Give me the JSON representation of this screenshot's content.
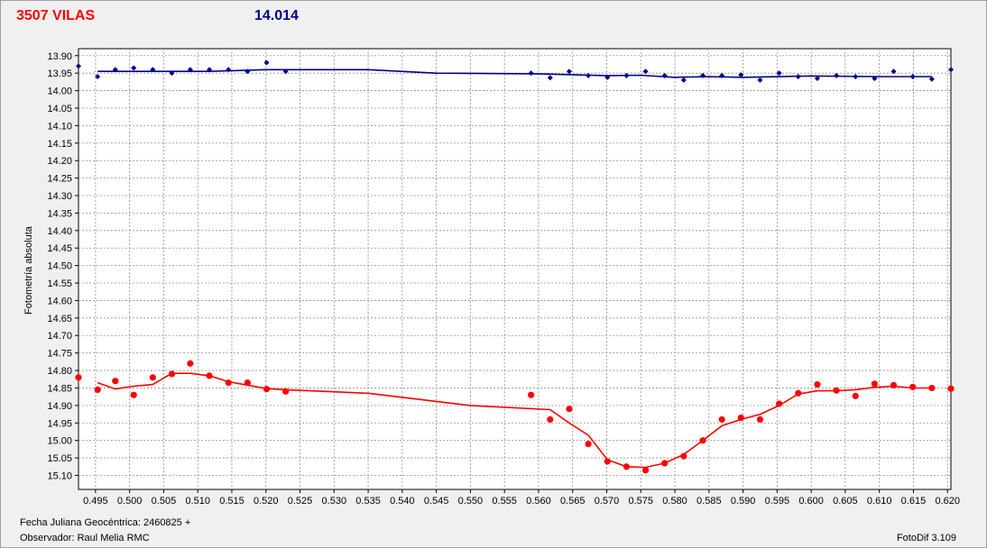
{
  "header": {
    "object_name": "3507 VILAS",
    "reference_value": "14.014"
  },
  "footer": {
    "jd_label": "Fecha Juliana Geocéntrica: 2460825 +",
    "observer": "Observador: Raul Melia RMC",
    "software": "FotoDif 3.109"
  },
  "colors": {
    "series_blue": "#00008b",
    "series_red": "#ff0000",
    "title_red": "#ff0000",
    "title_blue": "#00008b",
    "grid": "#909090"
  },
  "chart_data": {
    "type": "scatter",
    "title": "",
    "xlabel": "",
    "ylabel": "Fotometría absoluta",
    "xlim": [
      0.4925,
      0.6205
    ],
    "ylim": [
      13.88,
      15.14
    ],
    "y_inverted": true,
    "grid": true,
    "x_ticks": [
      0.495,
      0.5,
      0.505,
      0.51,
      0.515,
      0.52,
      0.525,
      0.53,
      0.535,
      0.54,
      0.545,
      0.55,
      0.555,
      0.56,
      0.565,
      0.57,
      0.575,
      0.58,
      0.585,
      0.59,
      0.595,
      0.6,
      0.605,
      0.61,
      0.615,
      0.62
    ],
    "y_ticks": [
      13.9,
      13.95,
      14.0,
      14.05,
      14.1,
      14.15,
      14.2,
      14.25,
      14.3,
      14.35,
      14.4,
      14.45,
      14.5,
      14.55,
      14.6,
      14.65,
      14.7,
      14.75,
      14.8,
      14.85,
      14.9,
      14.95,
      15.0,
      15.05,
      15.1
    ],
    "series": [
      {
        "color": "#00008b",
        "points": [
          [
            0.4925,
            13.93
          ],
          [
            0.4953,
            13.96
          ],
          [
            0.4979,
            13.94
          ],
          [
            0.5006,
            13.935
          ],
          [
            0.5034,
            13.94
          ],
          [
            0.5062,
            13.95
          ],
          [
            0.5089,
            13.94
          ],
          [
            0.5117,
            13.94
          ],
          [
            0.5145,
            13.94
          ],
          [
            0.5173,
            13.945
          ],
          [
            0.5201,
            13.92
          ],
          [
            0.5229,
            13.945
          ],
          [
            0.5589,
            13.95
          ],
          [
            0.5617,
            13.963
          ],
          [
            0.5645,
            13.945
          ],
          [
            0.5673,
            13.957
          ],
          [
            0.5701,
            13.962
          ],
          [
            0.5729,
            13.957
          ],
          [
            0.5757,
            13.945
          ],
          [
            0.5785,
            13.957
          ],
          [
            0.5813,
            13.97
          ],
          [
            0.5841,
            13.957
          ],
          [
            0.5869,
            13.957
          ],
          [
            0.5897,
            13.955
          ],
          [
            0.5925,
            13.97
          ],
          [
            0.5953,
            13.95
          ],
          [
            0.5981,
            13.96
          ],
          [
            0.6009,
            13.965
          ],
          [
            0.6037,
            13.957
          ],
          [
            0.6065,
            13.96
          ],
          [
            0.6093,
            13.965
          ],
          [
            0.6121,
            13.945
          ],
          [
            0.6149,
            13.96
          ],
          [
            0.6177,
            13.967
          ],
          [
            0.6205,
            13.94
          ]
        ],
        "fit": [
          [
            0.4953,
            13.945
          ],
          [
            0.5034,
            13.945
          ],
          [
            0.5117,
            13.945
          ],
          [
            0.52,
            13.94
          ],
          [
            0.535,
            13.94
          ],
          [
            0.545,
            13.95
          ],
          [
            0.56,
            13.952
          ],
          [
            0.57,
            13.957
          ],
          [
            0.575,
            13.956
          ],
          [
            0.58,
            13.962
          ],
          [
            0.585,
            13.96
          ],
          [
            0.59,
            13.962
          ],
          [
            0.6,
            13.958
          ],
          [
            0.61,
            13.96
          ],
          [
            0.6177,
            13.96
          ]
        ]
      },
      {
        "color": "#ff0000",
        "points": [
          [
            0.4925,
            14.82
          ],
          [
            0.4953,
            14.855
          ],
          [
            0.4979,
            14.83
          ],
          [
            0.5006,
            14.87
          ],
          [
            0.5034,
            14.82
          ],
          [
            0.5062,
            14.81
          ],
          [
            0.5089,
            14.78
          ],
          [
            0.5117,
            14.815
          ],
          [
            0.5145,
            14.835
          ],
          [
            0.5173,
            14.835
          ],
          [
            0.5201,
            14.853
          ],
          [
            0.5229,
            14.86
          ],
          [
            0.5589,
            14.87
          ],
          [
            0.5617,
            14.94
          ],
          [
            0.5645,
            14.91
          ],
          [
            0.5673,
            15.01
          ],
          [
            0.5701,
            15.06
          ],
          [
            0.5729,
            15.075
          ],
          [
            0.5757,
            15.085
          ],
          [
            0.5785,
            15.065
          ],
          [
            0.5813,
            15.045
          ],
          [
            0.5841,
            15.0
          ],
          [
            0.5869,
            14.94
          ],
          [
            0.5897,
            14.935
          ],
          [
            0.5925,
            14.94
          ],
          [
            0.5953,
            14.895
          ],
          [
            0.5981,
            14.865
          ],
          [
            0.6009,
            14.84
          ],
          [
            0.6037,
            14.857
          ],
          [
            0.6065,
            14.873
          ],
          [
            0.6093,
            14.838
          ],
          [
            0.6121,
            14.842
          ],
          [
            0.6149,
            14.847
          ],
          [
            0.6177,
            14.85
          ],
          [
            0.6205,
            14.852
          ]
        ],
        "fit": [
          [
            0.4953,
            14.835
          ],
          [
            0.4979,
            14.853
          ],
          [
            0.5006,
            14.845
          ],
          [
            0.5034,
            14.84
          ],
          [
            0.5062,
            14.808
          ],
          [
            0.5089,
            14.808
          ],
          [
            0.5117,
            14.815
          ],
          [
            0.5145,
            14.832
          ],
          [
            0.5173,
            14.842
          ],
          [
            0.5201,
            14.852
          ],
          [
            0.5229,
            14.855
          ],
          [
            0.535,
            14.865
          ],
          [
            0.55,
            14.9
          ],
          [
            0.5617,
            14.912
          ],
          [
            0.5645,
            14.95
          ],
          [
            0.5673,
            14.985
          ],
          [
            0.5701,
            15.055
          ],
          [
            0.5729,
            15.075
          ],
          [
            0.5757,
            15.077
          ],
          [
            0.5785,
            15.065
          ],
          [
            0.5813,
            15.04
          ],
          [
            0.5841,
            15.0
          ],
          [
            0.5869,
            14.958
          ],
          [
            0.5897,
            14.94
          ],
          [
            0.5925,
            14.925
          ],
          [
            0.5953,
            14.9
          ],
          [
            0.5981,
            14.867
          ],
          [
            0.6009,
            14.858
          ],
          [
            0.6037,
            14.858
          ],
          [
            0.6065,
            14.855
          ],
          [
            0.6093,
            14.848
          ],
          [
            0.6121,
            14.845
          ],
          [
            0.6149,
            14.85
          ],
          [
            0.6177,
            14.85
          ]
        ]
      }
    ]
  }
}
